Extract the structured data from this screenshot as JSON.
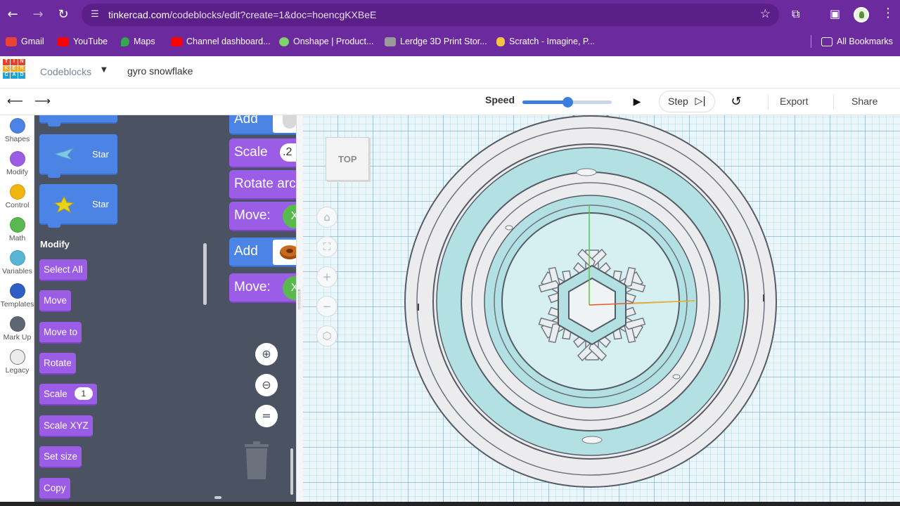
{
  "browser": {
    "url_host": "tinkercad.com",
    "url_path": "/codeblocks/edit?create=1&doc=hoencgKXBeE",
    "bookmarks": [
      {
        "label": "Gmail",
        "color": "#ea4335"
      },
      {
        "label": "YouTube",
        "color": "#ff0000"
      },
      {
        "label": "Maps",
        "color": "#34a853"
      },
      {
        "label": "Channel dashboard...",
        "color": "#ff0000"
      },
      {
        "label": "Onshape | Product...",
        "color": "#7fd36a"
      },
      {
        "label": "Lerdge 3D Print Stor...",
        "color": "#9a9a9a"
      },
      {
        "label": "Scratch - Imagine, P...",
        "color": "#f5c542"
      }
    ],
    "all_bookmarks": "All Bookmarks"
  },
  "app": {
    "logo_letters": [
      "T",
      "I",
      "N",
      "K",
      "E",
      "R",
      "C",
      "A",
      "D"
    ],
    "mode": "Codeblocks",
    "project_name": "gyro snowflake"
  },
  "toolbar": {
    "speed_label": "Speed",
    "speed_value": 0.5,
    "step_label": "Step",
    "export_label": "Export",
    "share_label": "Share"
  },
  "categories": [
    {
      "label": "Shapes",
      "color": "#4c84e6"
    },
    {
      "label": "Modify",
      "color": "#9b5de5"
    },
    {
      "label": "Control",
      "color": "#f2b50f"
    },
    {
      "label": "Math",
      "color": "#59b94f"
    },
    {
      "label": "Variables",
      "color": "#5ab4d6"
    },
    {
      "label": "Templates",
      "color": "#2f5fc4"
    },
    {
      "label": "Mark Up",
      "color": "#5d6675"
    },
    {
      "label": "Legacy",
      "color": "#ececec"
    }
  ],
  "palette": {
    "shape_blocks": [
      "Star",
      "Star"
    ],
    "modify_title": "Modify",
    "modify_blocks": [
      "Select All",
      "Move",
      "Move to",
      "Rotate",
      "Scale",
      "Scale XYZ",
      "Set size",
      "Copy"
    ],
    "scale_value": "1"
  },
  "script": {
    "blocks": [
      {
        "label": "Add",
        "kind": "blue"
      },
      {
        "label": "Scale",
        "kind": "purple",
        "input": ".2"
      },
      {
        "label": "Rotate arc",
        "kind": "purple"
      },
      {
        "label": "Move:",
        "kind": "purple",
        "x": "X"
      },
      {
        "label": "Add",
        "kind": "blue"
      },
      {
        "label": "Move:",
        "kind": "purple",
        "x": "X"
      }
    ]
  },
  "viewport": {
    "view_label": "TOP"
  }
}
